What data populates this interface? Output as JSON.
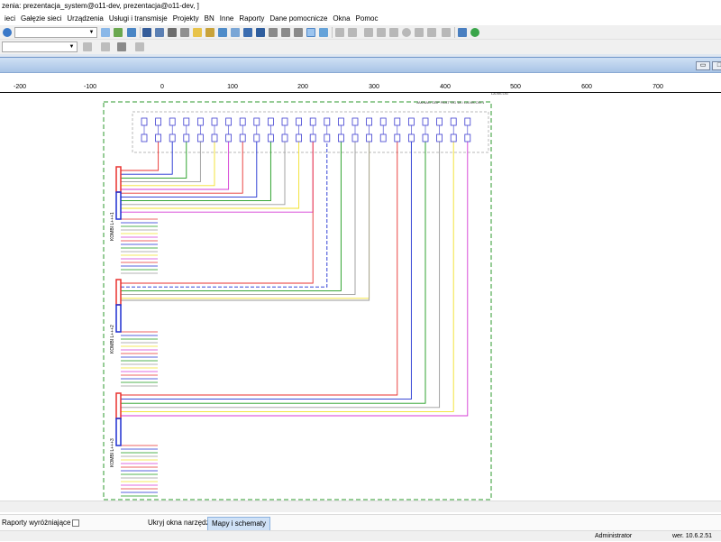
{
  "window": {
    "title": "zenia: prezentacja_system@o11-dev, prezentacja@o11-dev, ]"
  },
  "menu": [
    "ieci",
    "Gałęzie sieci",
    "Urządzenia",
    "Usługi i transmisje",
    "Projekty",
    "BN",
    "Inne",
    "Raporty",
    "Dane pomocnicze",
    "Okna",
    "Pomoc"
  ],
  "toolbar": {
    "combo_value": ""
  },
  "ruler": {
    "ticks": [
      "-200",
      "-100",
      "0",
      "100",
      "200",
      "300",
      "400",
      "500",
      "600",
      "700"
    ]
  },
  "diagram": {
    "header_label": "JAKNAG ODF PAST OG 18 / LA.NS.OG.1",
    "header_label_side": "LA.NS.OG",
    "cable_labels": [
      "KOMBI L+++1",
      "KOMBI L+++2",
      "KOMBI L+++3"
    ],
    "colors": {
      "red": "#e8312f",
      "blue": "#1f2fd1",
      "green": "#1a9a1a",
      "gray": "#9a9a9a",
      "yellow": "#f2e02a",
      "magenta": "#d43ad4",
      "frame": "#2e9a2e"
    }
  },
  "bottom": {
    "reports_label": "Raporty wyróżniające",
    "hide_tools_label": "Ukryj okna narzędzi",
    "maps_tab_label": "Mapy i schematy"
  },
  "status": {
    "user": "Administrator",
    "version": "wer. 10.6.2.51"
  }
}
